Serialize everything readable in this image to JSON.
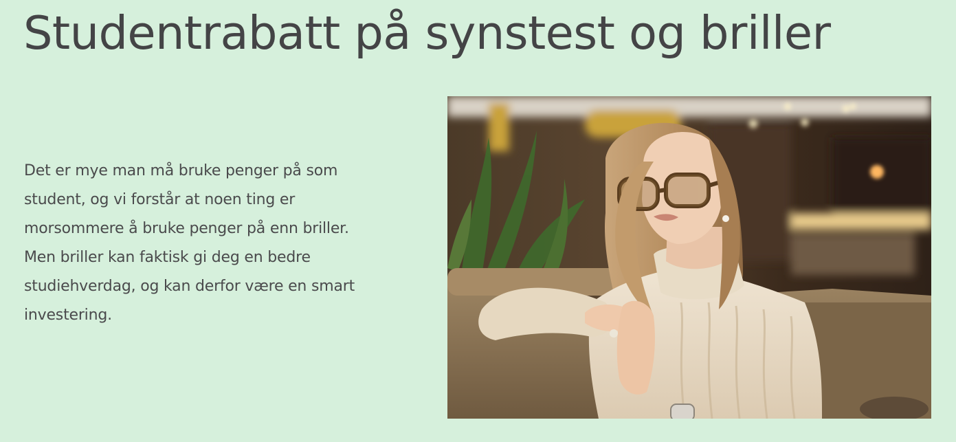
{
  "page": {
    "title": "Studentrabatt på synstest og briller",
    "intro_lines": [
      "Det er mye man må bruke penger på som",
      "student, og vi forstår at noen ting er",
      "morsommere å bruke penger på enn briller.",
      "Men briller kan faktisk gi deg en bedre",
      "studiehverdag, og kan derfor være en smart",
      "investering."
    ]
  },
  "colors": {
    "background": "#d6f0dc",
    "text": "#444446"
  },
  "photo": {
    "subject": "woman-with-glasses-in-cafe"
  }
}
